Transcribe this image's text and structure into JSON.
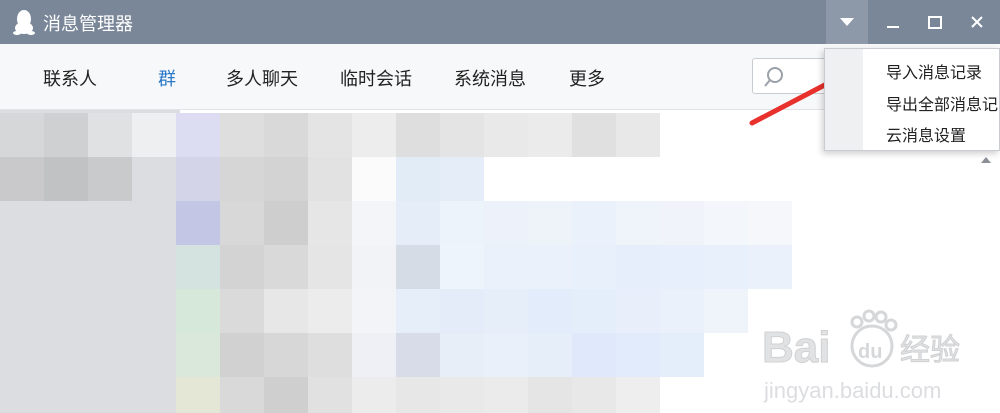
{
  "window": {
    "title": "消息管理器"
  },
  "tabs": [
    {
      "label": "联系人",
      "active": false
    },
    {
      "label": "群",
      "active": true
    },
    {
      "label": "多人聊天",
      "active": false
    },
    {
      "label": "临时会话",
      "active": false
    },
    {
      "label": "系统消息",
      "active": false
    },
    {
      "label": "更多",
      "active": false
    }
  ],
  "search": {
    "icon": "search-icon"
  },
  "dropdown": {
    "items": [
      "导入消息记录",
      "导出全部消息记",
      "云消息设置"
    ]
  },
  "colors": {
    "titlebar": "#7a8799",
    "accent": "#2a78c8",
    "annotation": "#e8302c"
  },
  "watermark": {
    "brand": "Baidu经验",
    "url": "jingyan.baidu.com"
  }
}
